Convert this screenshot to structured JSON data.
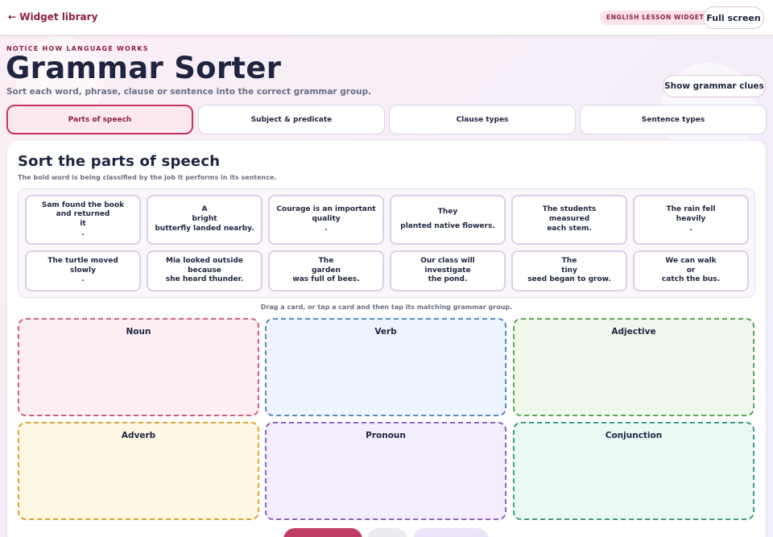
{
  "topbar": {
    "back_label": "← Widget library",
    "badge": "ENGLISH LESSON WIDGET",
    "fullscreen_label": "Full screen"
  },
  "header": {
    "eyebrow": "NOTICE HOW LANGUAGE WORKS",
    "title": "Grammar Sorter",
    "subtitle": "Sort each word, phrase, clause or sentence into the correct grammar group.",
    "clues_label": "Show grammar clues"
  },
  "tabs": [
    {
      "label": "Parts of speech",
      "active": true
    },
    {
      "label": "Subject & predicate",
      "active": false
    },
    {
      "label": "Clause types",
      "active": false
    },
    {
      "label": "Sentence types",
      "active": false
    }
  ],
  "panel": {
    "title": "Sort the parts of speech",
    "description": "The bold word is being classified by the job it performs in its sentence.",
    "hint": "Drag a card, or tap a card and then tap its matching grammar group."
  },
  "cards": [
    {
      "lines": [
        "Sam found the book and returned",
        "it",
        "."
      ]
    },
    {
      "lines": [
        "A",
        "bright",
        "butterfly landed nearby."
      ]
    },
    {
      "lines": [
        "Courage is an important",
        "quality",
        "."
      ]
    },
    {
      "lines": [
        "They",
        "planted native flowers."
      ]
    },
    {
      "lines": [
        "The students",
        "measured",
        "each stem."
      ]
    },
    {
      "lines": [
        "The rain fell",
        "heavily",
        "."
      ]
    },
    {
      "lines": [
        "The turtle moved",
        "slowly",
        "."
      ]
    },
    {
      "lines": [
        "Mia looked outside",
        "because",
        "she heard thunder."
      ]
    },
    {
      "lines": [
        "The",
        "garden",
        "was full of bees."
      ]
    },
    {
      "lines": [
        "Our class will",
        "investigate",
        "the pond."
      ]
    },
    {
      "lines": [
        "The",
        "tiny",
        "seed began to grow."
      ]
    },
    {
      "lines": [
        "We can walk",
        "or",
        "catch the bus."
      ]
    }
  ],
  "bins": [
    {
      "label": "Noun",
      "border": "#d35d8c",
      "fill": "#fdeef3"
    },
    {
      "label": "Verb",
      "border": "#5a89c2",
      "fill": "#eef4fd"
    },
    {
      "label": "Adjective",
      "border": "#5aa85a",
      "fill": "#eff8ea"
    },
    {
      "label": "Adverb",
      "border": "#e0a432",
      "fill": "#fef7e4"
    },
    {
      "label": "Pronoun",
      "border": "#8f62c7",
      "fill": "#f4eefc"
    },
    {
      "label": "Conjunction",
      "border": "#3f9e86",
      "fill": "#ebf9f3"
    }
  ],
  "colors": {
    "accent": "#c2345f",
    "accent_dark": "#8c1f4a",
    "text": "#1f2541"
  }
}
